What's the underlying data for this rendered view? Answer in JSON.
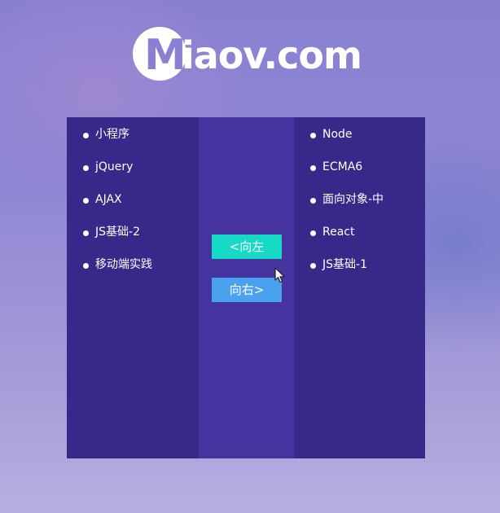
{
  "logo": {
    "letter": "M",
    "rest": "iaov.com"
  },
  "left_list": {
    "items": [
      "小程序",
      "jQuery",
      "AJAX",
      "JS基础-2",
      "移动端实践"
    ]
  },
  "right_list": {
    "items": [
      "Node",
      "ECMA6",
      "面向对象-中",
      "React",
      "JS基础-1"
    ]
  },
  "buttons": {
    "move_left": "<向左",
    "move_right": "向右>"
  },
  "colors": {
    "panel": "#37298a",
    "middle": "#4633a0",
    "move_left_button": "#16d9c6",
    "move_right_button": "#4aa2ee"
  },
  "icons": {
    "cursor": "arrow-cursor-icon"
  }
}
